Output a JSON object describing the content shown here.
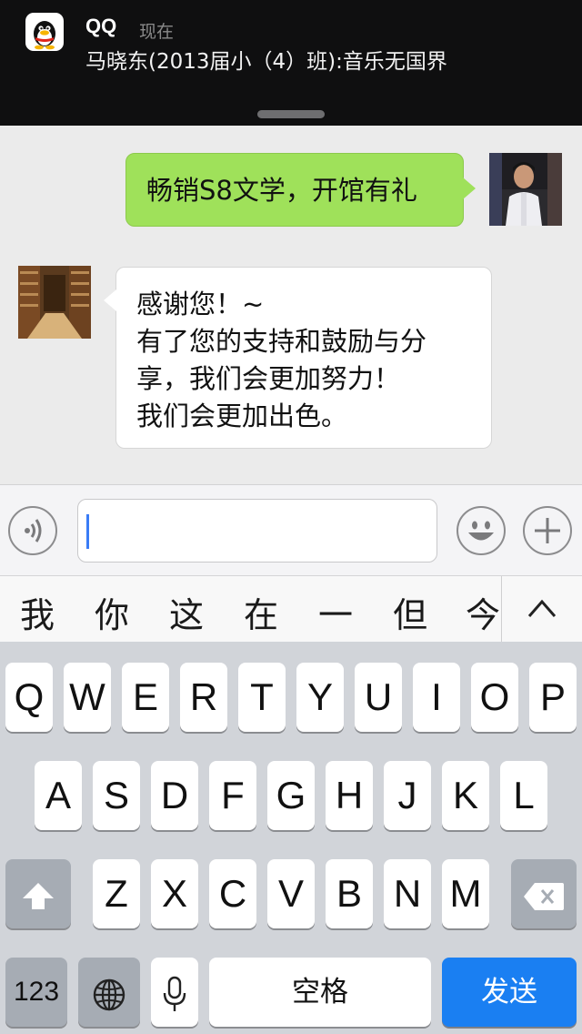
{
  "notification": {
    "app_name": "QQ",
    "time": "现在",
    "message": "马晓东(2013届小（4）班):音乐无国界"
  },
  "chat": {
    "outgoing": {
      "text": "畅销S8文学，开馆有礼"
    },
    "incoming": {
      "lines": [
        "感谢您！~",
        "有了您的支持和鼓励与分",
        "享，我们会更加努力！",
        "我们会更加出色。"
      ]
    }
  },
  "input": {
    "value": "",
    "placeholder": ""
  },
  "candidates": [
    "我",
    "你",
    "这",
    "在",
    "一",
    "但",
    "今"
  ],
  "keyboard": {
    "row1": [
      "Q",
      "W",
      "E",
      "R",
      "T",
      "Y",
      "U",
      "I",
      "O",
      "P"
    ],
    "row2": [
      "A",
      "S",
      "D",
      "F",
      "G",
      "H",
      "J",
      "K",
      "L"
    ],
    "row3": [
      "Z",
      "X",
      "C",
      "V",
      "B",
      "N",
      "M"
    ],
    "numbers_label": "123",
    "space_label": "空格",
    "send_label": "发送"
  },
  "colors": {
    "outgoing_bubble": "#9fe15a",
    "send_key": "#1a7ff2",
    "keyboard_bg": "#d1d4d9"
  },
  "icons": [
    "qq-penguin-icon",
    "voice-icon",
    "emoji-icon",
    "plus-icon",
    "chevron-up-icon",
    "shift-icon",
    "backspace-icon",
    "globe-icon",
    "microphone-icon"
  ]
}
